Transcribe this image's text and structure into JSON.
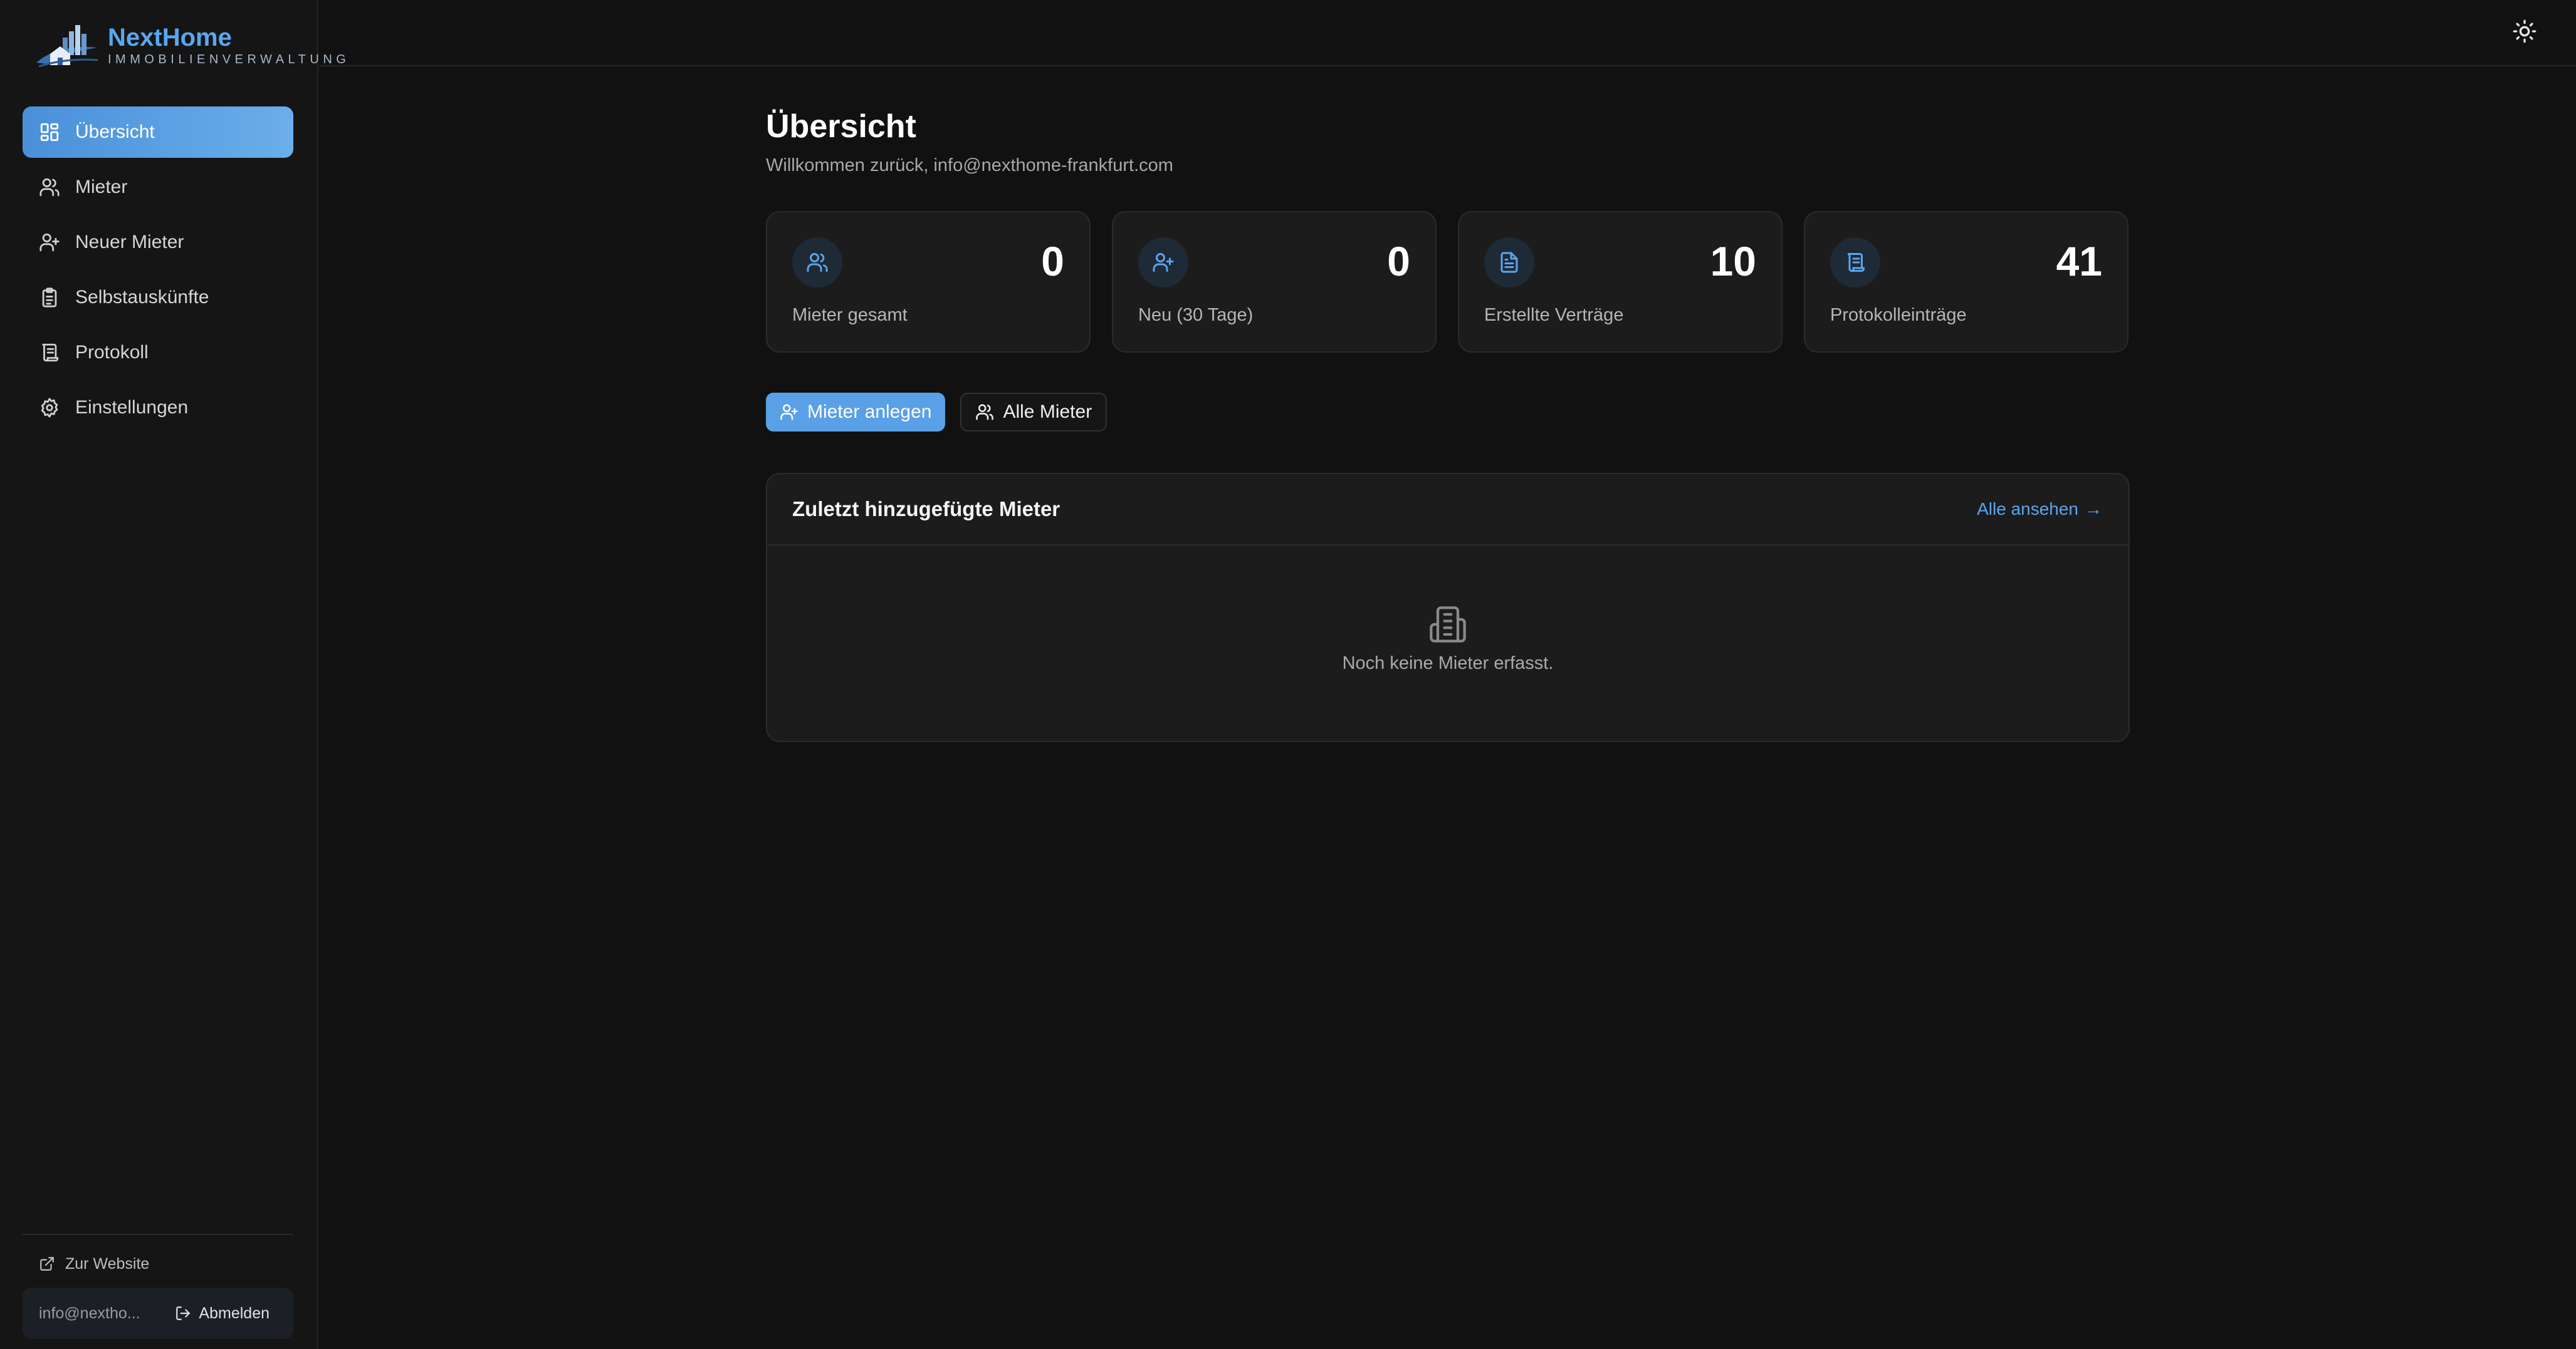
{
  "brand": {
    "name": "NextHome",
    "subtitle": "IMMOBILIENVERWALTUNG"
  },
  "sidebar": {
    "items": [
      {
        "label": "Übersicht",
        "icon": "dashboard-icon",
        "active": true
      },
      {
        "label": "Mieter",
        "icon": "users-icon",
        "active": false
      },
      {
        "label": "Neuer Mieter",
        "icon": "user-plus-icon",
        "active": false
      },
      {
        "label": "Selbstauskünfte",
        "icon": "clipboard-icon",
        "active": false
      },
      {
        "label": "Protokoll",
        "icon": "scroll-icon",
        "active": false
      },
      {
        "label": "Einstellungen",
        "icon": "gear-icon",
        "active": false
      }
    ],
    "website_link": "Zur Website",
    "user_email": "info@nextho...",
    "logout_label": "Abmelden"
  },
  "topbar": {
    "theme_toggle_icon": "sun-icon"
  },
  "main": {
    "title": "Übersicht",
    "subtitle": "Willkommen zurück, info@nexthome-frankfurt.com",
    "stats": [
      {
        "value": "0",
        "label": "Mieter gesamt",
        "icon": "users-icon"
      },
      {
        "value": "0",
        "label": "Neu (30 Tage)",
        "icon": "user-plus-icon"
      },
      {
        "value": "10",
        "label": "Erstellte Verträge",
        "icon": "document-icon"
      },
      {
        "value": "41",
        "label": "Protokolleinträge",
        "icon": "scroll-icon"
      }
    ],
    "actions": {
      "primary": "Mieter anlegen",
      "secondary": "Alle Mieter"
    },
    "recent": {
      "title": "Zuletzt hinzugefügte Mieter",
      "link": "Alle ansehen",
      "link_arrow": "→",
      "empty_text": "Noch keine Mieter erfasst."
    }
  },
  "colors": {
    "accent": "#5aa6ee",
    "background": "#111111",
    "card": "#1c1c1c"
  }
}
